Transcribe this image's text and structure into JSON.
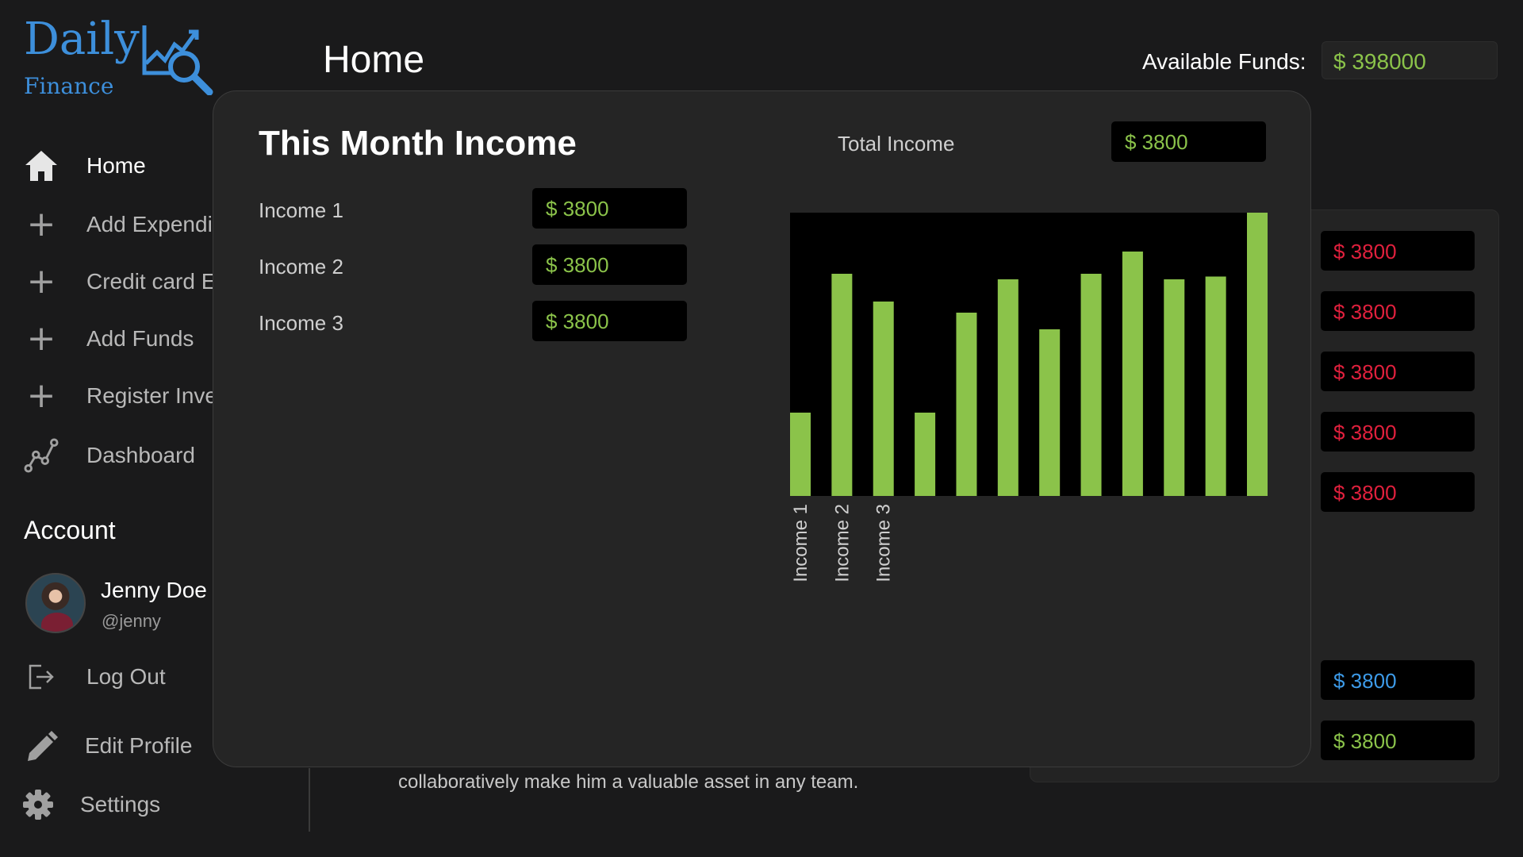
{
  "logo": {
    "word": "Daily",
    "sub": "Finance"
  },
  "header": {
    "title": "Home",
    "funds_label": "Available Funds:",
    "funds_value": "$ 398000"
  },
  "sidebar": {
    "items": [
      {
        "label": "Home",
        "icon": "home-icon"
      },
      {
        "label": "Add Expenditure",
        "icon": "plus-icon"
      },
      {
        "label": "Credit card Expense",
        "icon": "plus-icon"
      },
      {
        "label": "Add Funds",
        "icon": "plus-icon"
      },
      {
        "label": "Register Investment",
        "icon": "plus-icon"
      },
      {
        "label": "Dashboard",
        "icon": "dashboard-icon"
      }
    ],
    "account_title": "Account",
    "user": {
      "name": "Jenny Doe",
      "handle": "@jenny"
    },
    "bottom": [
      {
        "label": "Log Out",
        "icon": "logout-icon"
      },
      {
        "label": "Edit Profile",
        "icon": "pencil-icon"
      },
      {
        "label": "Settings",
        "icon": "gear-icon"
      }
    ]
  },
  "background": {
    "text": "collaboratively make him a valuable asset in any team.",
    "right_values": [
      {
        "value": "$ 3800",
        "color": "#e0203d"
      },
      {
        "value": "$ 3800",
        "color": "#e0203d"
      },
      {
        "value": "$ 3800",
        "color": "#e0203d"
      },
      {
        "value": "$ 3800",
        "color": "#e0203d"
      },
      {
        "value": "$ 3800",
        "color": "#e0203d"
      },
      {
        "value": "$ 3800",
        "color": "#3d9be9"
      },
      {
        "value": "$ 3800",
        "color": "#8bc34a"
      }
    ]
  },
  "modal": {
    "title": "This Month Income",
    "total_label": "Total Income",
    "total_value": "$ 3800",
    "incomes": [
      {
        "label": "Income 1",
        "value": "$ 3800"
      },
      {
        "label": "Income 2",
        "value": "$ 3800"
      },
      {
        "label": "Income 3",
        "value": "$ 3800"
      }
    ]
  },
  "chart_data": {
    "type": "bar",
    "categories": [
      "Income 1",
      "Income 2",
      "Income 3",
      "",
      "",
      "",
      "",
      "",
      "",
      "",
      "",
      "",
      ""
    ],
    "values": [
      30,
      80,
      70,
      30,
      66,
      78,
      60,
      80,
      88,
      78,
      79,
      102
    ],
    "ylim": [
      0,
      102
    ],
    "bar_color": "#8bc34a",
    "background": "#000000",
    "grid": false
  },
  "colors": {
    "accent_green": "#8bc34a",
    "accent_blue": "#3d8fdb",
    "expense_red": "#e0203d"
  }
}
